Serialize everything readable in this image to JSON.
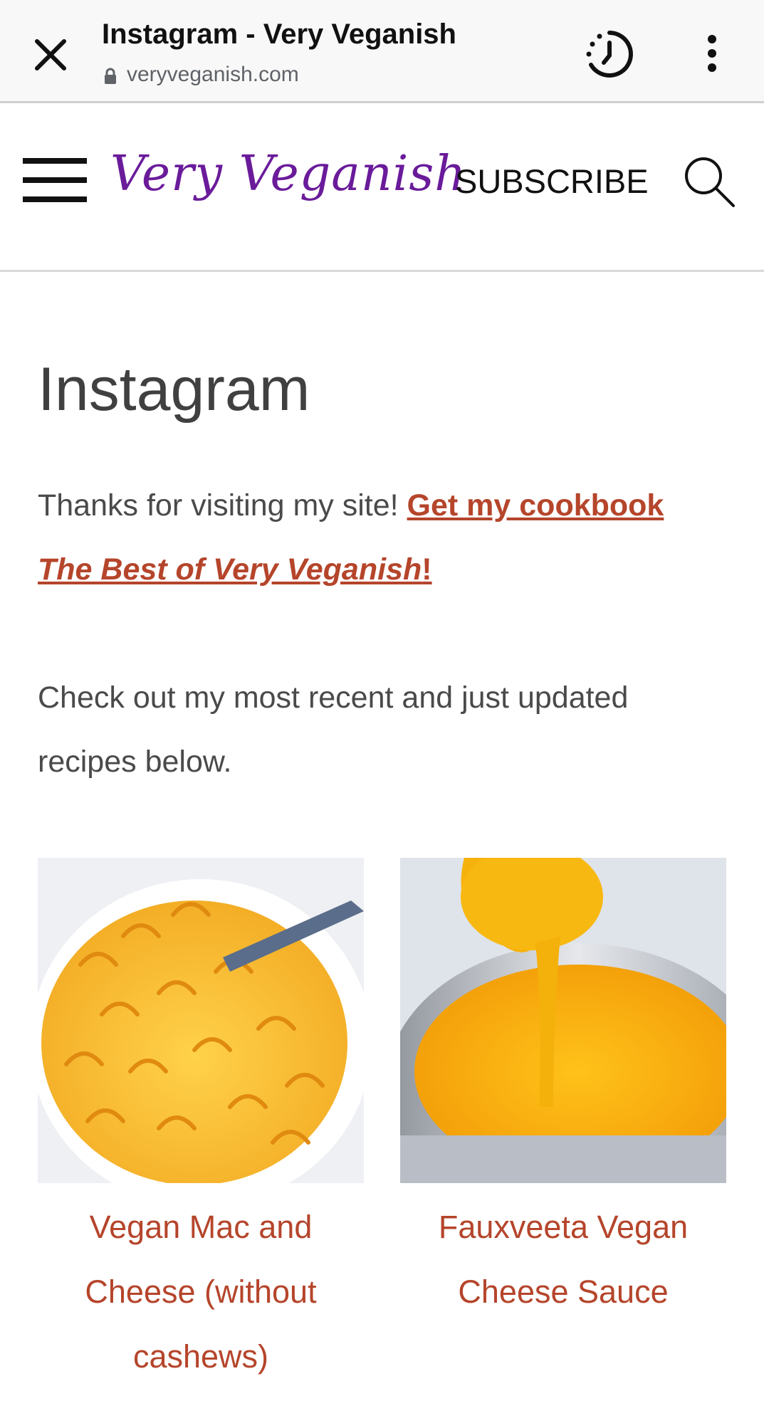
{
  "toolbar": {
    "title": "Instagram - Very Veganish",
    "url": "veryveganish.com"
  },
  "site_header": {
    "logo": "Very Veganish",
    "subscribe": "SUBSCRIBE"
  },
  "main": {
    "page_title": "Instagram",
    "intro_text": "Thanks for visiting my site! ",
    "cookbook_link_prefix": "Get my cookbook ",
    "cookbook_link_title": "The Best of Very Veganish",
    "cookbook_link_suffix": "!",
    "recent_text": "Check out my most recent and just updated recipes below.",
    "recipes": [
      {
        "title": "Vegan Mac and Cheese (without cashews)"
      },
      {
        "title": "Fauxveeta Vegan Cheese Sauce"
      }
    ]
  },
  "colors": {
    "link": "#b5452b",
    "logo": "#6a1b9a",
    "toolbar_bg": "#f8f8f8"
  }
}
